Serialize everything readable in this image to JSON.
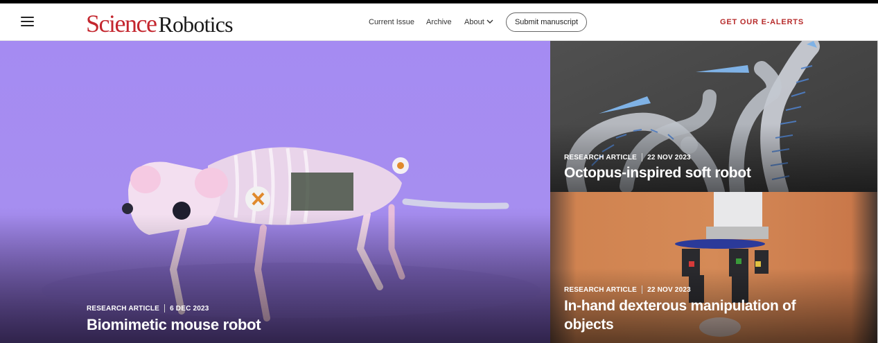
{
  "header": {
    "logo_science": "Science",
    "logo_robotics": "Robotics",
    "nav": {
      "current_issue": "Current Issue",
      "archive": "Archive",
      "about": "About"
    },
    "submit_label": "Submit manuscript",
    "alerts_label": "GET OUR E-ALERTS"
  },
  "features": [
    {
      "type": "RESEARCH ARTICLE",
      "date": "6 DEC 2023",
      "title": "Biomimetic mouse robot"
    },
    {
      "type": "RESEARCH ARTICLE",
      "date": "22 NOV 2023",
      "title": "Octopus-inspired soft robot"
    },
    {
      "type": "RESEARCH ARTICLE",
      "date": "22 NOV 2023",
      "title": "In-hand dexterous manipulation of objects"
    }
  ],
  "colors": {
    "brand_red": "#c4262e",
    "alerts_red": "#b72b2b",
    "hero_purple": "#a48af0",
    "octopus_bg": "#4a4a4a",
    "hand_bg": "#c97848"
  }
}
